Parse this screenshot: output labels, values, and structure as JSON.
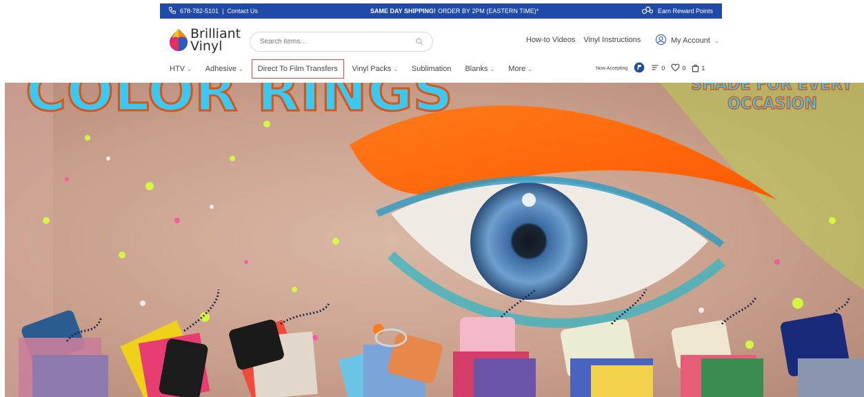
{
  "topbar": {
    "phone": "678-782-5101",
    "separator": "|",
    "contact": "Contact Us",
    "shipping_bold": "SAME DAY SHIPPING!",
    "shipping_rest": "ORDER BY 2PM (EASTERN TIME)*",
    "rewards": "Earn Reward Points",
    "bg_color": "#1f4aa8"
  },
  "header": {
    "logo_line1": "Brilliant",
    "logo_line2": "Vinyl",
    "search_placeholder": "Search items...",
    "how_to": "How-to Videos",
    "instructions": "Vinyl Instructions",
    "account": "My Account"
  },
  "nav": {
    "items": [
      {
        "label": "HTV",
        "chevron": true
      },
      {
        "label": "Adhesive",
        "chevron": true
      },
      {
        "label": "Direct To Film Transfers",
        "chevron": false
      },
      {
        "label": "Vinyl Packs",
        "chevron": true
      },
      {
        "label": "Sublimation",
        "chevron": false
      },
      {
        "label": "Blanks",
        "chevron": true
      },
      {
        "label": "More",
        "chevron": true
      }
    ],
    "now_accepting": "Now Accepting",
    "compare_count": "0",
    "wishlist_count": "0",
    "cart_count": "1",
    "highlight_color": "#e04545"
  },
  "hero": {
    "headline": "COLOR RINGS",
    "side_text_line1": "SHADE FOR EVERY",
    "side_text_line2": "OCCASION",
    "headline_color": "#3fc8ef"
  }
}
